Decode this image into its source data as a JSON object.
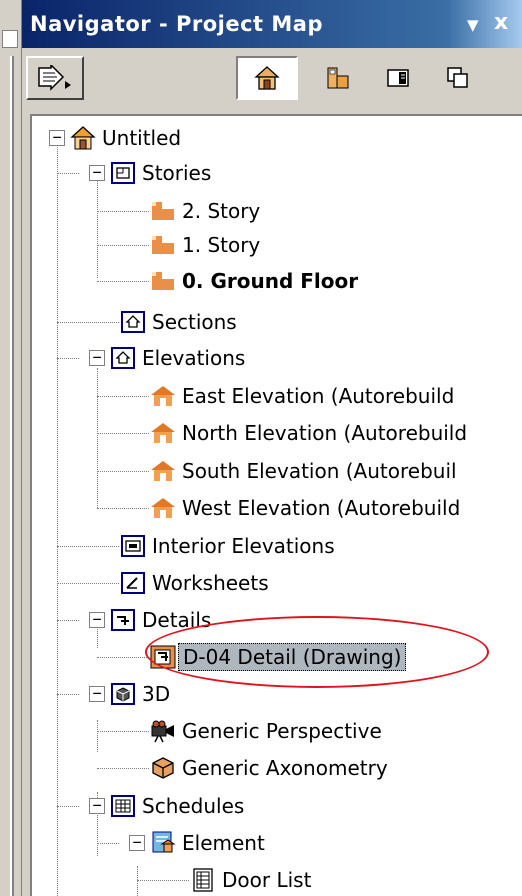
{
  "window": {
    "title": "Navigator - Project Map",
    "dropdown_glyph": "▼",
    "close_glyph": "x"
  },
  "toolbar": {
    "buttons": [
      {
        "name": "navigator-menu-button",
        "icon": "arrow-menu-icon"
      },
      {
        "name": "project-map-button",
        "icon": "house-icon",
        "active": true
      },
      {
        "name": "view-map-button",
        "icon": "floorplan-icon"
      },
      {
        "name": "layout-book-button",
        "icon": "layout-icon"
      },
      {
        "name": "publisher-sets-button",
        "icon": "publisher-icon"
      }
    ]
  },
  "tree": {
    "root": "Untitled",
    "stories": "Stories",
    "story_2": "2. Story",
    "story_1": "1. Story",
    "story_0": "0. Ground Floor",
    "sections": "Sections",
    "elevations": "Elevations",
    "east_elevation": "East Elevation (Autorebuild",
    "north_elevation": "North Elevation (Autorebuild",
    "south_elevation": "South Elevation (Autorebuil",
    "west_elevation": "West Elevation (Autorebuild",
    "interior_elevations": "Interior Elevations",
    "worksheets": "Worksheets",
    "details": "Details",
    "detail_d04": "D-04 Detail (Drawing)",
    "three_d": "3D",
    "generic_perspective": "Generic Perspective",
    "generic_axonometry": "Generic Axonometry",
    "schedules": "Schedules",
    "element": "Element",
    "door_list": "Door List",
    "collapse_glyph": "−"
  },
  "colors": {
    "title_gradient_start": "#0a246a",
    "highlight_oval": "#e0141e",
    "selection_bg": "#aeb6be"
  }
}
